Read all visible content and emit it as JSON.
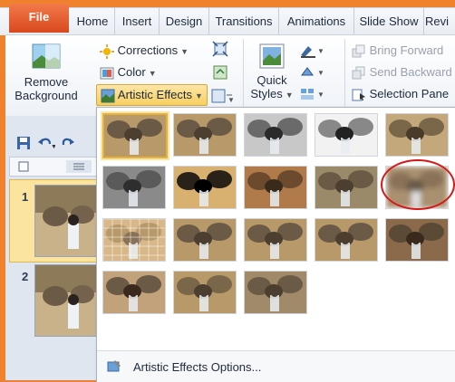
{
  "tabs": {
    "file": "File",
    "items": [
      "Home",
      "Insert",
      "Design",
      "Transitions",
      "Animations",
      "Slide Show",
      "Revi"
    ]
  },
  "ribbon": {
    "remove_background": {
      "line1": "Remove",
      "line2": "Background"
    },
    "corrections": "Corrections",
    "color": "Color",
    "artistic_effects": "Artistic Effects",
    "quick_styles": {
      "line1": "Quick",
      "line2": "Styles"
    },
    "bring_forward": "Bring Forward",
    "send_backward": "Send Backward",
    "selection_pane": "Selection Pane"
  },
  "slides": [
    {
      "number": "1"
    },
    {
      "number": "2"
    }
  ],
  "gallery": {
    "rows": 4,
    "columns": 5,
    "count": 18,
    "selected_index": 0,
    "highlighted_index": 9,
    "footer": "Artistic Effects Options..."
  }
}
